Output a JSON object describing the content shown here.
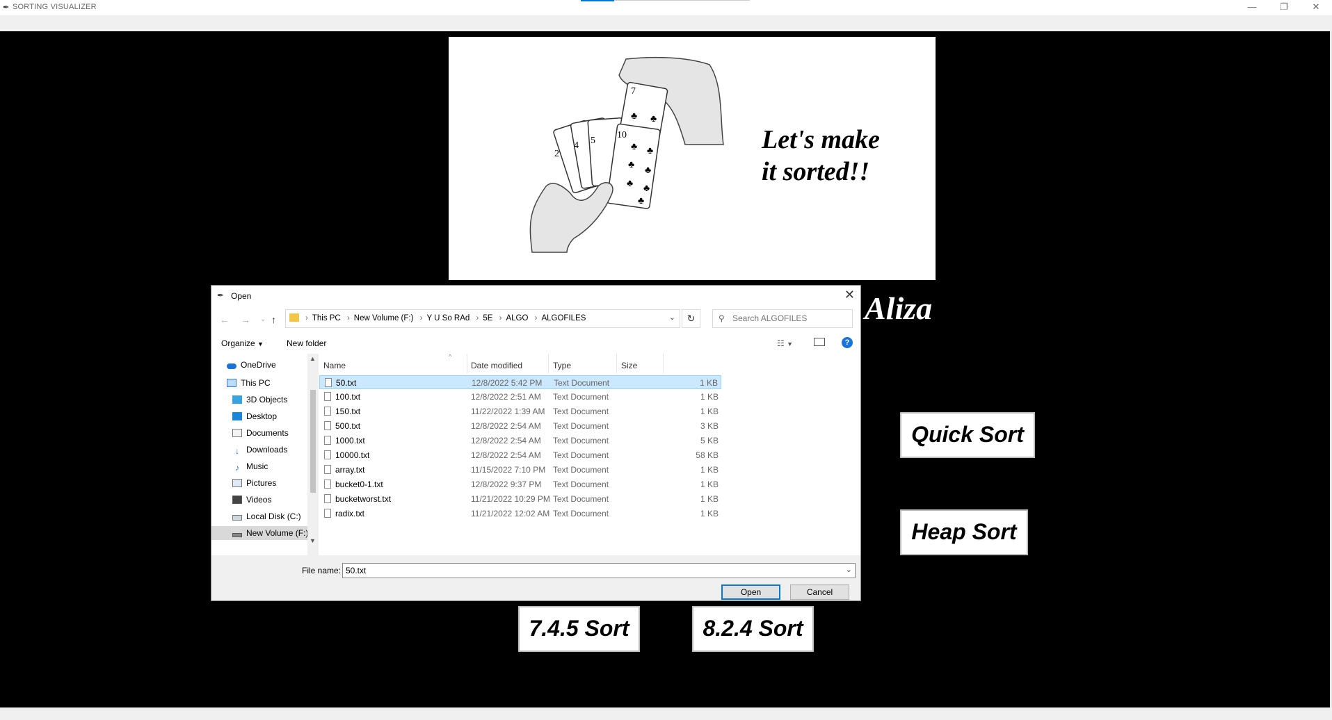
{
  "window": {
    "title": "SORTING VISUALIZER",
    "icon": "feather-icon",
    "controls": [
      "minimize-icon",
      "restore-icon",
      "close-icon"
    ]
  },
  "banner": {
    "line1": "Let's make",
    "line2": "it sorted!!",
    "image": "hand-holding-cards-illustration",
    "cards": {
      "back_fan": [
        "2",
        "4",
        "5"
      ],
      "front": "10",
      "top": "7"
    }
  },
  "author": "Aliza",
  "buttons": {
    "quick_sort": "Quick Sort",
    "heap_sort": "Heap Sort",
    "sort_745": "7.4.5 Sort",
    "sort_824": "8.2.4 Sort"
  },
  "dialog": {
    "title": "Open",
    "breadcrumb": [
      "This PC",
      "New Volume (F:)",
      "Y U So RAd",
      "5E",
      "ALGO",
      "ALGOFILES"
    ],
    "search_placeholder": "Search ALGOFILES",
    "toolbar": {
      "organize": "Organize",
      "new_folder": "New folder"
    },
    "nav": [
      {
        "label": "OneDrive",
        "icon": "cloud-icon"
      },
      {
        "label": "This PC",
        "icon": "computer-icon"
      },
      {
        "label": "3D Objects",
        "icon": "cube-icon"
      },
      {
        "label": "Desktop",
        "icon": "desktop-icon"
      },
      {
        "label": "Documents",
        "icon": "documents-icon"
      },
      {
        "label": "Downloads",
        "icon": "download-icon"
      },
      {
        "label": "Music",
        "icon": "music-icon"
      },
      {
        "label": "Pictures",
        "icon": "pictures-icon"
      },
      {
        "label": "Videos",
        "icon": "videos-icon"
      },
      {
        "label": "Local Disk (C:)",
        "icon": "drive-icon"
      },
      {
        "label": "New Volume (F:)",
        "icon": "drive-icon"
      }
    ],
    "columns": [
      "Name",
      "Date modified",
      "Type",
      "Size"
    ],
    "files": [
      {
        "name": "50.txt",
        "date": "12/8/2022 5:42 PM",
        "type": "Text Document",
        "size": "1 KB"
      },
      {
        "name": "100.txt",
        "date": "12/8/2022 2:51 AM",
        "type": "Text Document",
        "size": "1 KB"
      },
      {
        "name": "150.txt",
        "date": "11/22/2022 1:39 AM",
        "type": "Text Document",
        "size": "1 KB"
      },
      {
        "name": "500.txt",
        "date": "12/8/2022 2:54 AM",
        "type": "Text Document",
        "size": "3 KB"
      },
      {
        "name": "1000.txt",
        "date": "12/8/2022 2:54 AM",
        "type": "Text Document",
        "size": "5 KB"
      },
      {
        "name": "10000.txt",
        "date": "12/8/2022 2:54 AM",
        "type": "Text Document",
        "size": "58 KB"
      },
      {
        "name": "array.txt",
        "date": "11/15/2022 7:10 PM",
        "type": "Text Document",
        "size": "1 KB"
      },
      {
        "name": "bucket0-1.txt",
        "date": "12/8/2022 9:37 PM",
        "type": "Text Document",
        "size": "1 KB"
      },
      {
        "name": "bucketworst.txt",
        "date": "11/21/2022 10:29 PM",
        "type": "Text Document",
        "size": "1 KB"
      },
      {
        "name": "radix.txt",
        "date": "11/21/2022 12:02 AM",
        "type": "Text Document",
        "size": "1 KB"
      }
    ],
    "filename_label": "File name:",
    "filename_value": "50.txt",
    "open_label": "Open",
    "cancel_label": "Cancel"
  }
}
